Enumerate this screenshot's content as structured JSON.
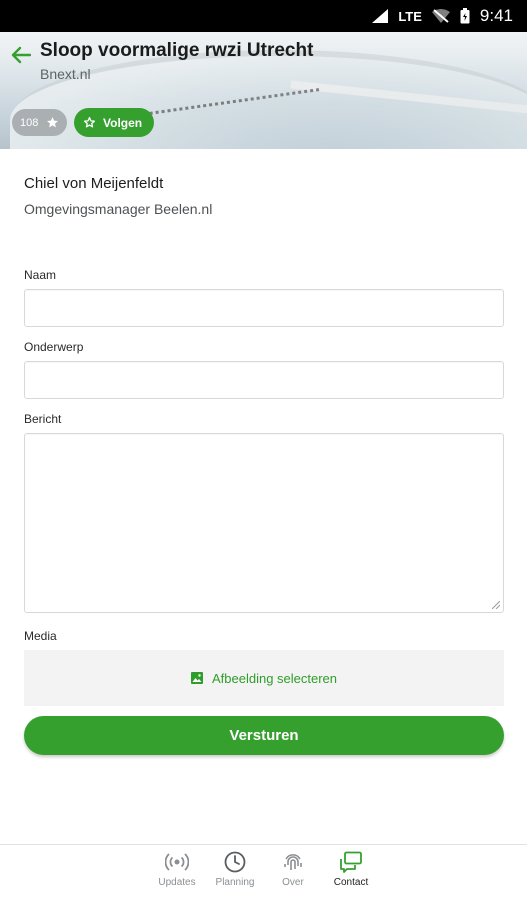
{
  "status_bar": {
    "network": "LTE",
    "time": "9:41"
  },
  "header": {
    "title": "Sloop voormalige rwzi Utrecht",
    "subtitle": "Bnext.nl",
    "follower_count": "108",
    "follow_label": "Volgen"
  },
  "contact": {
    "name": "Chiel von Meijenfeldt",
    "role": "Omgevingsmanager Beelen.nl"
  },
  "form": {
    "name_label": "Naam",
    "name_value": "",
    "subject_label": "Onderwerp",
    "subject_value": "",
    "message_label": "Bericht",
    "message_value": "",
    "media_label": "Media",
    "media_button": "Afbeelding selecteren",
    "submit_label": "Versturen"
  },
  "nav": {
    "items": [
      {
        "label": "Updates",
        "icon": "broadcast-icon",
        "active": false
      },
      {
        "label": "Planning",
        "icon": "clock-icon",
        "active": false
      },
      {
        "label": "Over",
        "icon": "fingerprint-icon",
        "active": false
      },
      {
        "label": "Contact",
        "icon": "contact-icon",
        "active": true
      }
    ]
  },
  "colors": {
    "accent": "#36a02f",
    "status_bar": "#000000"
  }
}
